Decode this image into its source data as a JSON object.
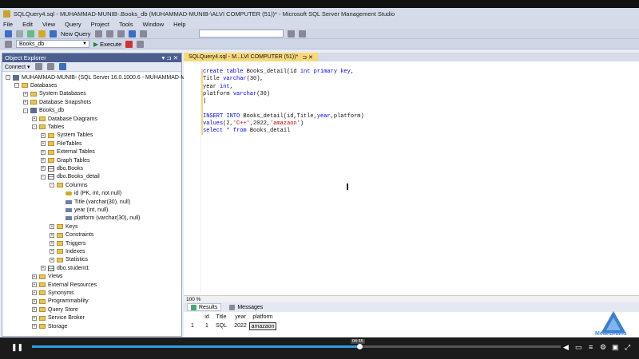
{
  "window": {
    "title": "SQLQuery4.sql - MUHAMMAD-MUNIB-.Books_db (MUHAMMAD-MUNIB-\\ALVI COMPUTER (51))* - Microsoft SQL Server Management Studio"
  },
  "menu": [
    "File",
    "Edit",
    "View",
    "Query",
    "Project",
    "Tools",
    "Window",
    "Help"
  ],
  "toolbar": {
    "new_query_label": "New Query",
    "database_select": "Books_db",
    "execute_label": "Execute"
  },
  "object_explorer": {
    "title": "Object Explorer",
    "pin": "▾ ⊐ ✕",
    "connect_label": "Connect ▾",
    "tree": [
      {
        "label": "MUHAMMAD-MUNIB- (SQL Server 16.0.1000.6 - MUHAMMAD-M",
        "level": 0,
        "icon": "server-icon",
        "exp": "-"
      },
      {
        "label": "Databases",
        "level": 1,
        "icon": "folder-icon",
        "exp": "-"
      },
      {
        "label": "System Databases",
        "level": 2,
        "icon": "folder-icon",
        "exp": "+"
      },
      {
        "label": "Database Snapshots",
        "level": 2,
        "icon": "folder-icon",
        "exp": "+"
      },
      {
        "label": "Books_db",
        "level": 2,
        "icon": "database-icon",
        "exp": "-"
      },
      {
        "label": "Database Diagrams",
        "level": 3,
        "icon": "folder-icon",
        "exp": "+"
      },
      {
        "label": "Tables",
        "level": 3,
        "icon": "folder-icon",
        "exp": "-"
      },
      {
        "label": "System Tables",
        "level": 4,
        "icon": "folder-icon",
        "exp": "+"
      },
      {
        "label": "FileTables",
        "level": 4,
        "icon": "folder-icon",
        "exp": "+"
      },
      {
        "label": "External Tables",
        "level": 4,
        "icon": "folder-icon",
        "exp": "+"
      },
      {
        "label": "Graph Tables",
        "level": 4,
        "icon": "folder-icon",
        "exp": "+"
      },
      {
        "label": "dbo.Books",
        "level": 4,
        "icon": "table-icon",
        "exp": "+"
      },
      {
        "label": "dbo.Books_detail",
        "level": 4,
        "icon": "table-icon",
        "exp": "-"
      },
      {
        "label": "Columns",
        "level": 5,
        "icon": "folder-icon",
        "exp": "-"
      },
      {
        "label": "id (PK, int, not null)",
        "level": 6,
        "icon": "key-icon",
        "exp": ""
      },
      {
        "label": "Title (varchar(30), null)",
        "level": 6,
        "icon": "column-icon",
        "exp": ""
      },
      {
        "label": "year (int, null)",
        "level": 6,
        "icon": "column-icon",
        "exp": ""
      },
      {
        "label": "platform (varchar(30), null)",
        "level": 6,
        "icon": "column-icon",
        "exp": ""
      },
      {
        "label": "Keys",
        "level": 5,
        "icon": "folder-icon",
        "exp": "+"
      },
      {
        "label": "Constraints",
        "level": 5,
        "icon": "folder-icon",
        "exp": "+"
      },
      {
        "label": "Triggers",
        "level": 5,
        "icon": "folder-icon",
        "exp": "+"
      },
      {
        "label": "Indexes",
        "level": 5,
        "icon": "folder-icon",
        "exp": "+"
      },
      {
        "label": "Statistics",
        "level": 5,
        "icon": "folder-icon",
        "exp": "+"
      },
      {
        "label": "dbo.student1",
        "level": 4,
        "icon": "table-icon",
        "exp": "+"
      },
      {
        "label": "Views",
        "level": 3,
        "icon": "folder-icon",
        "exp": "+"
      },
      {
        "label": "External Resources",
        "level": 3,
        "icon": "folder-icon",
        "exp": "+"
      },
      {
        "label": "Synonyms",
        "level": 3,
        "icon": "folder-icon",
        "exp": "+"
      },
      {
        "label": "Programmability",
        "level": 3,
        "icon": "folder-icon",
        "exp": "+"
      },
      {
        "label": "Query Store",
        "level": 3,
        "icon": "folder-icon",
        "exp": "+"
      },
      {
        "label": "Service Broker",
        "level": 3,
        "icon": "folder-icon",
        "exp": "+"
      },
      {
        "label": "Storage",
        "level": 3,
        "icon": "folder-icon",
        "exp": "+"
      }
    ]
  },
  "editor": {
    "tab_label": "SQLQuery4.sql - M...LVI COMPUTER (51))*",
    "tab_controls": "⊐ ✕",
    "zoom": "100 %",
    "lines": [
      [
        {
          "t": "create table ",
          "k": "kw"
        },
        {
          "t": "Books_detail(id ",
          "k": ""
        },
        {
          "t": "int primary key",
          "k": "kw"
        },
        {
          "t": ",",
          "k": ""
        }
      ],
      [
        {
          "t": "Title ",
          "k": ""
        },
        {
          "t": "varchar",
          "k": "kw"
        },
        {
          "t": "(30),",
          "k": ""
        }
      ],
      [
        {
          "t": "year ",
          "k": ""
        },
        {
          "t": "int",
          "k": "kw"
        },
        {
          "t": ",",
          "k": ""
        }
      ],
      [
        {
          "t": "platform ",
          "k": ""
        },
        {
          "t": "varchar",
          "k": "kw"
        },
        {
          "t": "(30)",
          "k": ""
        }
      ],
      [
        {
          "t": ")",
          "k": ""
        }
      ],
      [
        {
          "t": "",
          "k": ""
        }
      ],
      [
        {
          "t": "INSERT INTO ",
          "k": "kw"
        },
        {
          "t": "Books_detail(id,Title,",
          "k": ""
        },
        {
          "t": "year",
          "k": "kw"
        },
        {
          "t": ",platform)",
          "k": ""
        }
      ],
      [
        {
          "t": "values",
          "k": "kw"
        },
        {
          "t": "(2,",
          "k": ""
        },
        {
          "t": "'C++'",
          "k": "str"
        },
        {
          "t": ",2022,",
          "k": ""
        },
        {
          "t": "'amazaon'",
          "k": "str"
        },
        {
          "t": ")",
          "k": ""
        }
      ],
      [
        {
          "t": "select ",
          "k": "kw"
        },
        {
          "t": "* ",
          "k": ""
        },
        {
          "t": "from ",
          "k": "kw"
        },
        {
          "t": "Books_detail",
          "k": ""
        }
      ]
    ]
  },
  "results": {
    "tabs": [
      "Results",
      "Messages"
    ],
    "columns": [
      "id",
      "Title",
      "year",
      "platform"
    ],
    "rows": [
      {
        "rownum": "1",
        "cells": [
          "1",
          "SQL",
          "2022",
          "amazaon"
        ]
      }
    ]
  },
  "video": {
    "time_chip": "04:55",
    "progress": 0.62
  },
  "watermark": {
    "text": "Meta Brains"
  }
}
